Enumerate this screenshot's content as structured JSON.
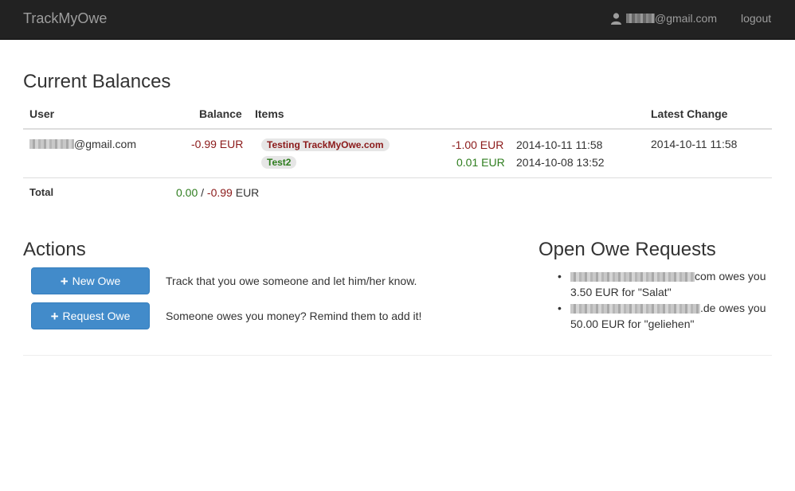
{
  "navbar": {
    "brand": "TrackMyOwe",
    "user_email_suffix": "@gmail.com",
    "logout_label": "logout",
    "user_icon": "user-icon"
  },
  "balances": {
    "title": "Current Balances",
    "columns": {
      "user": "User",
      "balance": "Balance",
      "items": "Items",
      "latest": "Latest Change"
    },
    "rows": [
      {
        "user_suffix": "@gmail.com",
        "balance": "-0.99 EUR",
        "items": [
          {
            "label": "Testing TrackMyOwe.com",
            "amount": "-1.00 EUR",
            "date": "2014-10-11 11:58"
          },
          {
            "label": "Test2",
            "amount": "0.01 EUR",
            "date": "2014-10-08 13:52"
          }
        ],
        "latest": "2014-10-11 11:58"
      }
    ],
    "total": {
      "label": "Total",
      "positive": "0.00",
      "separator": " / ",
      "negative": "-0.99",
      "currency": " EUR"
    }
  },
  "actions": {
    "title": "Actions",
    "new_owe_label": "New Owe",
    "new_owe_desc": "Track that you owe someone and let him/her know.",
    "request_owe_label": "Request Owe",
    "request_owe_desc": "Someone owes you money? Remind them to add it!"
  },
  "requests": {
    "title": "Open Owe Requests",
    "items": [
      {
        "email_suffix": "com",
        "text_line1": " owes you",
        "text_line2": "3.50 EUR for \"Salat\""
      },
      {
        "email_suffix": ".de",
        "text_line1": " owes you",
        "text_line2": "50.00 EUR for \"geliehen\""
      }
    ]
  },
  "colors": {
    "navbar_bg": "#222222",
    "primary": "#428bca",
    "negative": "#8b1a1a",
    "positive": "#2e7d1e"
  }
}
